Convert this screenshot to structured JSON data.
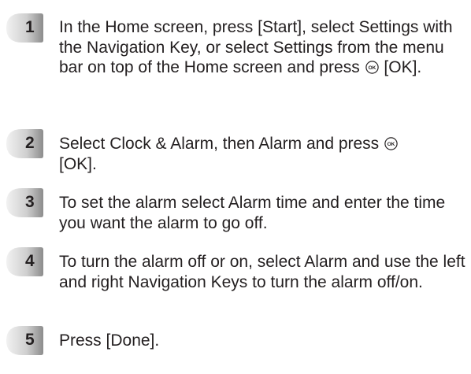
{
  "steps": [
    {
      "number": "1",
      "parts": [
        "In the Home screen, press [Start], select Settings with the Navigation Key, or select Settings from the menu bar on top of the Home screen and press ",
        " [OK]."
      ]
    },
    {
      "number": "2",
      "parts": [
        "Select Clock & Alarm, then Alarm and press ",
        " [OK]."
      ]
    },
    {
      "number": "3",
      "parts": [
        "To set the alarm select Alarm time and enter the time you want the alarm to go off."
      ]
    },
    {
      "number": "4",
      "parts": [
        "To turn the alarm off or on, select Alarm and use the left and right Navigation Keys to turn the alarm off/on."
      ]
    },
    {
      "number": "5",
      "parts": [
        "Press [Done]."
      ]
    }
  ],
  "ok_key_icon": "ok-key-icon",
  "ok_key_glyph": "OK",
  "colors": {
    "text": "#231f20",
    "badge_light": "#e6e6e6",
    "badge_dark": "#8c8c8c"
  }
}
